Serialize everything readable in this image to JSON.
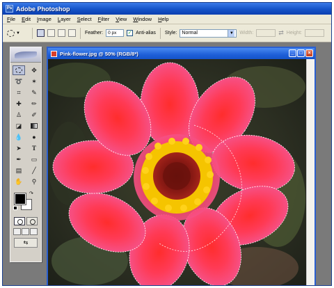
{
  "window": {
    "title": "Adobe Photoshop"
  },
  "menu": [
    "File",
    "Edit",
    "Image",
    "Layer",
    "Select",
    "Filter",
    "View",
    "Window",
    "Help"
  ],
  "options": {
    "feather_label": "Feather:",
    "feather_value": "0 px",
    "antialias_label": "Anti-alias",
    "antialias_checked": true,
    "style_label": "Style:",
    "style_value": "Normal",
    "width_label": "Width:",
    "height_label": "Height:"
  },
  "toolbox": {
    "tools": [
      "elliptical-marquee-tool",
      "move-tool",
      "lasso-tool",
      "magic-wand-tool",
      "crop-tool",
      "slice-tool",
      "healing-brush-tool",
      "brush-tool",
      "clone-stamp-tool",
      "history-brush-tool",
      "eraser-tool",
      "gradient-tool",
      "blur-tool",
      "dodge-tool",
      "path-selection-tool",
      "type-tool",
      "pen-tool",
      "rectangle-tool",
      "notes-tool",
      "eyedropper-tool",
      "hand-tool",
      "zoom-tool"
    ],
    "foreground_color": "#000000",
    "background_color": "#ffffff"
  },
  "document": {
    "title": "Pink-flower.jpg @ 50% (RGB/8*)",
    "zoom": "50%"
  },
  "colors": {
    "titlebar": "#1553c8",
    "petal": "#f0407a",
    "flower_center": "#8b1a14",
    "stamens": "#f5c400"
  }
}
